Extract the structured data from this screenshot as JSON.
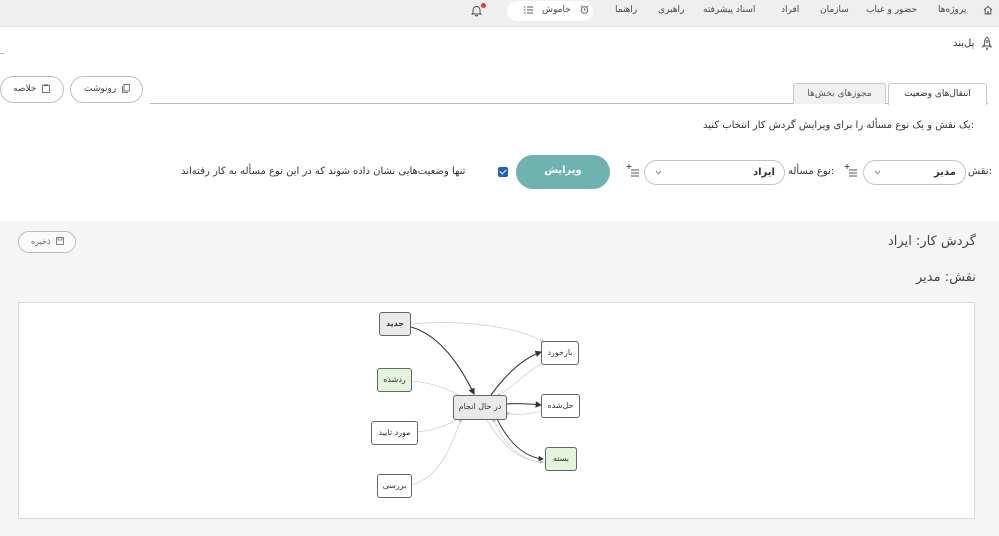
{
  "topbar": {
    "nav": [
      {
        "id": "projects",
        "label": "پروژه‌ها"
      },
      {
        "id": "attendance",
        "label": "حضور و غیاب"
      },
      {
        "id": "organization",
        "label": "سازمان"
      },
      {
        "id": "people",
        "label": "افراد"
      },
      {
        "id": "advanced-documents",
        "label": "اسناد پیشرفته"
      },
      {
        "id": "administration",
        "label": "راهبری"
      },
      {
        "id": "help",
        "label": "راهنما"
      }
    ],
    "off_button_label": "خاموش",
    "icons": {
      "home": "home-icon",
      "alarm": "alarm-clock-icon",
      "list": "list-icon",
      "bell": "bell-icon"
    },
    "notification_dot_color": "#e23b3b"
  },
  "page": {
    "title": "پل‌بند",
    "summary_button": "خلاصه",
    "transcript_button": "رونوشت",
    "tabs": [
      {
        "label": "انتقال‌های وضعیت",
        "active": true
      },
      {
        "label": "مجوزهای بخش‌ها",
        "active": false
      }
    ],
    "instruction": "یک نقش و یک نوع مسأله را برای ویرایش گردش کار انتخاب کنید:",
    "role_label": "نقش:",
    "role_value": "مدیر",
    "issue_type_label": "نوع مسأله:",
    "issue_type_value": "ایراد",
    "edit_button": "ویرایش",
    "only_used_states_checked": true,
    "only_used_states_label": "تنها وضعیت‌هایی نشان داده شوند که در این نوع مسأله به کار رفته‌اند",
    "accent_color": "#6fb3b1"
  },
  "workflow": {
    "title": "گردش کار: ایراد",
    "role_title": "نقش: مدیر",
    "save_button": "ذخیره",
    "nodes": [
      {
        "id": "new",
        "label": "جدید"
      },
      {
        "id": "rejected",
        "label": "ردشده"
      },
      {
        "id": "approved",
        "label": "مورد تایید"
      },
      {
        "id": "review",
        "label": "بررسی"
      },
      {
        "id": "in_progress",
        "label": "در حال انجام"
      },
      {
        "id": "feedback",
        "label": "بازخورد"
      },
      {
        "id": "resolved",
        "label": "حل‌شده"
      },
      {
        "id": "closed",
        "label": "بسته"
      }
    ]
  }
}
